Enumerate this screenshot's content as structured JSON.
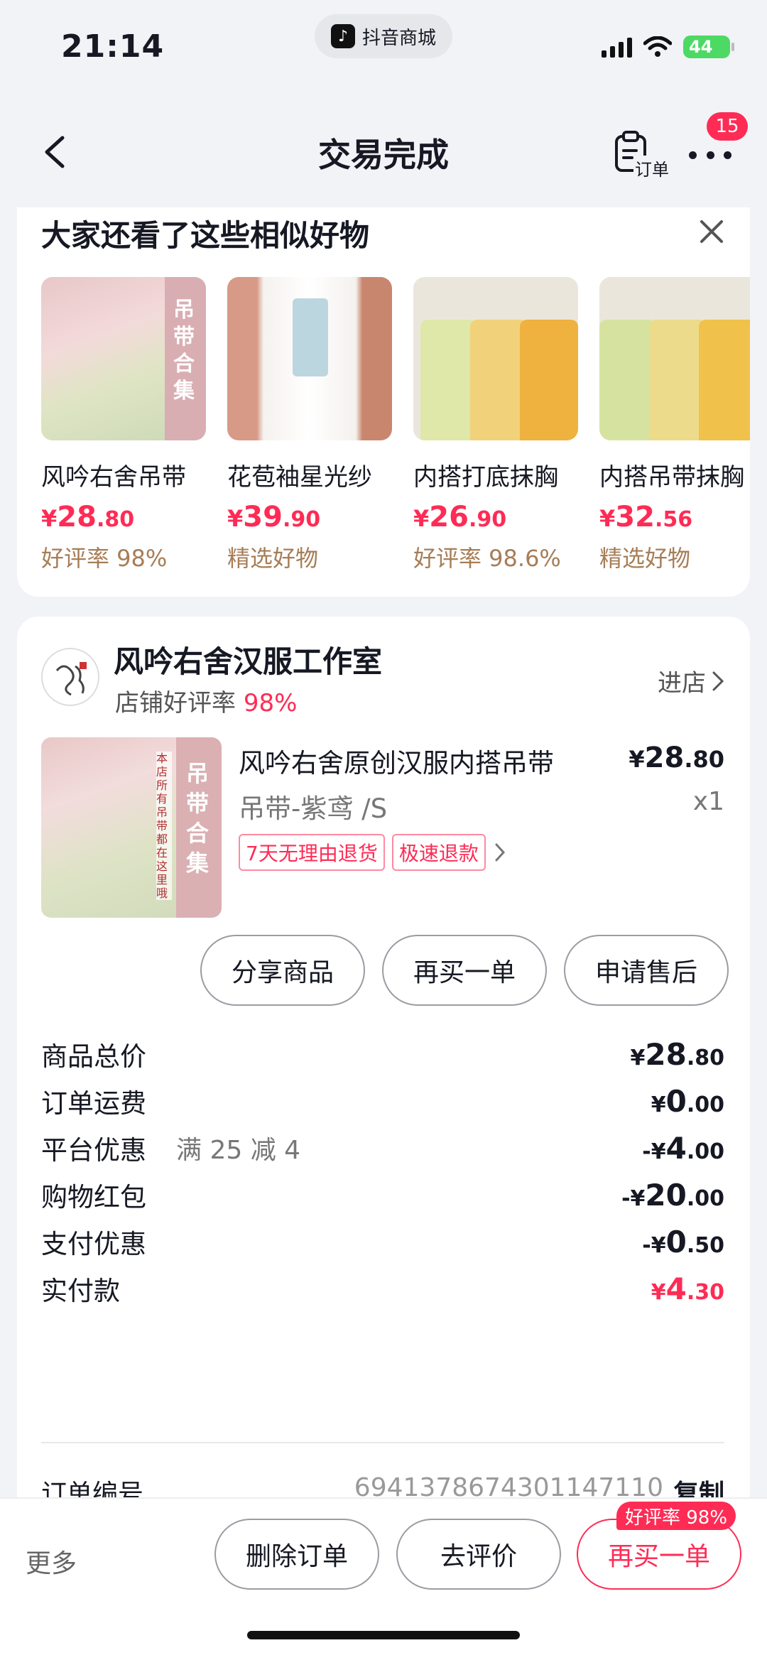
{
  "status": {
    "time": "21:14",
    "app_pill": "抖音商城",
    "battery": "44"
  },
  "nav": {
    "title": "交易完成",
    "order_label": "订单",
    "badge_count": "15"
  },
  "recommend": {
    "title": "大家还看了这些相似好物",
    "items": [
      {
        "name": "风吟右舍吊带",
        "price_int": "28",
        "price_dec": ".80",
        "tag": "好评率 98%"
      },
      {
        "name": "花苞袖星光纱",
        "price_int": "39",
        "price_dec": ".90",
        "tag": "精选好物"
      },
      {
        "name": "内搭打底抹胸",
        "price_int": "26",
        "price_dec": ".90",
        "tag": "好评率 98.6%"
      },
      {
        "name": "内搭吊带抹胸",
        "price_int": "32",
        "price_dec": ".56",
        "tag": "精选好物"
      }
    ]
  },
  "shop": {
    "name": "风吟右舍汉服工作室",
    "rating_label": "店铺好评率",
    "rating_value": "98%",
    "enter_label": "进店"
  },
  "product": {
    "title": "风吟右舍原创汉服内搭吊带",
    "price_int": "28",
    "price_dec": ".80",
    "spec": "吊带-紫鸢 /S",
    "qty": "x1",
    "tags": [
      "7天无理由退货",
      "极速退款"
    ],
    "image_text": [
      "吊带合集",
      "本店所有吊带都在这里哦"
    ]
  },
  "actions": [
    "分享商品",
    "再买一单",
    "申请售后"
  ],
  "fees": [
    {
      "label": "商品总价",
      "note": "",
      "prefix": "",
      "int": "28",
      "dec": ".80"
    },
    {
      "label": "订单运费",
      "note": "",
      "prefix": "",
      "int": "0",
      "dec": ".00"
    },
    {
      "label": "平台优惠",
      "note": "满 25 减 4",
      "prefix": "-",
      "int": "4",
      "dec": ".00"
    },
    {
      "label": "购物红包",
      "note": "",
      "prefix": "-",
      "int": "20",
      "dec": ".00"
    },
    {
      "label": "支付优惠",
      "note": "",
      "prefix": "-",
      "int": "0",
      "dec": ".50"
    },
    {
      "label": "实付款",
      "note": "",
      "prefix": "",
      "int": "4",
      "dec": ".30"
    }
  ],
  "currency": "¥",
  "order": {
    "label": "订单编号",
    "number": "6941378674301147110",
    "copy": "复制"
  },
  "bottom": {
    "more": "更多",
    "delete": "删除订单",
    "review": "去评价",
    "rebuy": "再买一单",
    "rebuy_badge": "好评率 98%"
  },
  "colors": {
    "accent": "#fe2c55",
    "tag_brown": "#a77d57"
  }
}
